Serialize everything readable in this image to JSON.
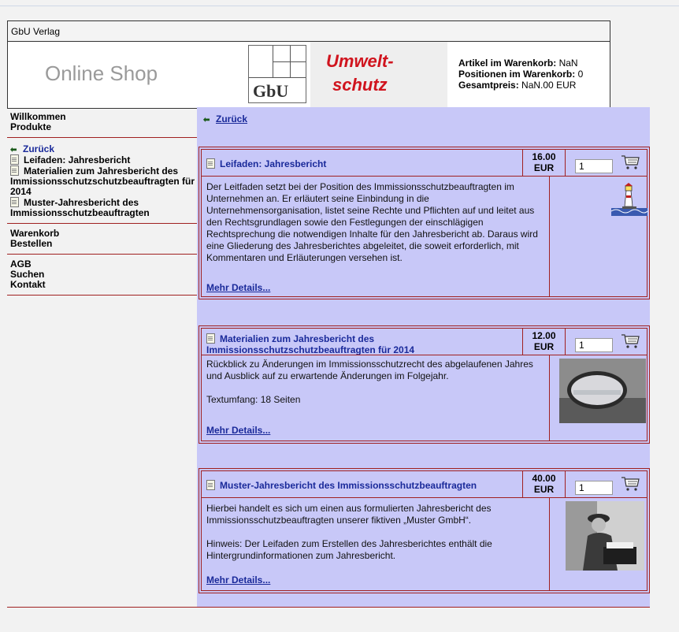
{
  "window": {
    "title": "GbU Verlag"
  },
  "header": {
    "shop_name": "Online Shop",
    "logo_text": "GbU",
    "slogan_line1": "Umwelt-",
    "slogan_line2": "schutz",
    "cart": {
      "items_label": "Artikel im Warenkorb:",
      "items_value": "NaN",
      "positions_label": "Positionen im Warenkorb:",
      "positions_value": "0",
      "total_label": "Gesamtpreis:",
      "total_value": "NaN.00 EUR"
    }
  },
  "sidebar": {
    "nav1": [
      "Willkommen",
      "Produkte"
    ],
    "back": "Zurück",
    "products": [
      "Leifaden: Jahresbericht",
      "Materialien zum Jahresbericht des Immissionsschutzschutzbeauftragten für 2014",
      "Muster-Jahresbericht des Immissionsschutzbeauftragten"
    ],
    "nav2": [
      "Warenkorb",
      "Bestellen"
    ],
    "nav3": [
      "AGB",
      "Suchen",
      "Kontakt"
    ]
  },
  "main": {
    "back": "Zurück",
    "more_label": "Mehr Details...",
    "products": [
      {
        "title": "Leifaden: Jahresbericht",
        "price": "16.00",
        "currency": "EUR",
        "qty": "1",
        "desc": [
          "Der Leitfaden setzt bei der Position des Immissionsschutzbeauftragten im Unternehmen an. Er erläutert seine Einbindung in die Unternehmensorganisation, listet seine Rechte und Pflichten auf und leitet aus den Rechtsgrundlagen sowie den Festlegungen der einschlägigen Rechtsprechung die notwendigen Inhalte für den Jahresbericht ab. Daraus wird eine Gliederung des Jahresberichtes abgeleitet, die soweit erforderlich, mit Kommentaren und Erläuterungen versehen ist."
        ]
      },
      {
        "title": "Materialien zum Jahresbericht des Immissionsschutzschutzbeauftragten für 2014",
        "price": "12.00",
        "currency": "EUR",
        "qty": "1",
        "desc": [
          "Rückblick zu Änderungen im Immissionsschutzrecht des abgelaufenen Jahres und Ausblick auf zu erwartende Änderungen im Folgejahr.",
          "Textumfang: 18 Seiten"
        ]
      },
      {
        "title": "Muster-Jahresbericht des Immissionsschutzbeauftragten",
        "price": "40.00",
        "currency": "EUR",
        "qty": "1",
        "desc": [
          "Hierbei handelt es sich um einen aus formulierten Jahresbericht des Immissionsschutzbeauftragten unserer fiktiven „Muster GmbH“.",
          "Hinweis: Der Leifaden zum Erstellen des Jahresberichtes enthält die Hintergrundinformationen zum Jahresbericht."
        ]
      }
    ]
  }
}
